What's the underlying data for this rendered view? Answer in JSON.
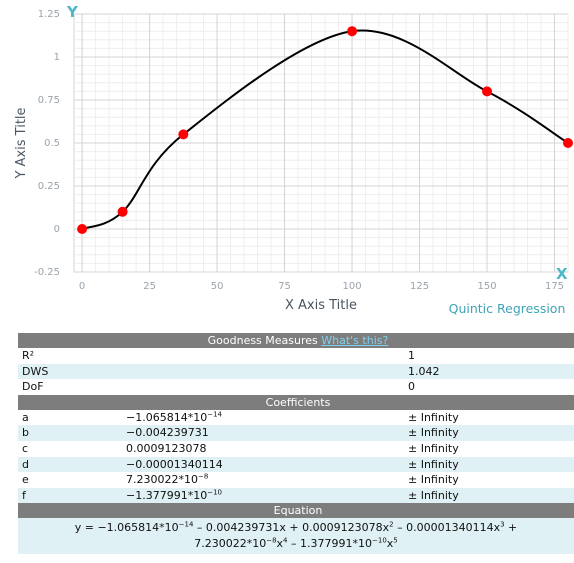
{
  "chart_data": {
    "type": "line",
    "xlabel": "X Axis Title",
    "ylabel": "Y Axis Title",
    "regression_label": "Quintic Regression",
    "axis_badges": {
      "y": "Y",
      "x": "X"
    },
    "xlim": [
      -3,
      180
    ],
    "ylim": [
      -0.25,
      1.25
    ],
    "x_ticks": [
      0,
      25,
      50,
      75,
      100,
      125,
      150,
      175
    ],
    "y_ticks": [
      -0.25,
      0,
      0.25,
      0.5,
      0.75,
      1,
      1.25
    ],
    "x_tick_labels": [
      "0",
      "25",
      "50",
      "75",
      "100",
      "125",
      "150",
      "175"
    ],
    "y_tick_labels": [
      "-0.25",
      "0",
      "0.25",
      "0.5",
      "0.75",
      "1",
      "1.25"
    ],
    "grid": true,
    "series": [
      {
        "points": [
          {
            "x": 0,
            "y": 0
          },
          {
            "x": 15,
            "y": 0.1
          },
          {
            "x": 37.5,
            "y": 0.55
          },
          {
            "x": 100,
            "y": 1.15
          },
          {
            "x": 150,
            "y": 0.8
          },
          {
            "x": 180,
            "y": 0.5
          }
        ],
        "point_color": "#ff0000",
        "curve_color": "#000000",
        "curve_coefficients": [
          -1.065814e-14,
          -0.004239731,
          0.0009123078,
          -1.340114e-05,
          7.230022e-08,
          -1.377991e-10
        ]
      }
    ]
  },
  "colors": {
    "accent": "#4fb6c6",
    "header_bar": "#7d7d7d",
    "row_alt": "#dff1f5",
    "point": "#ff0000",
    "link": "#7fd0ef"
  },
  "table": {
    "goodness_header": "Goodness Measures",
    "whats_this": "What's this?",
    "goodness": [
      {
        "label": "R²",
        "value": "1"
      },
      {
        "label": "DWS",
        "value": "1.042"
      },
      {
        "label": "DoF",
        "value": "0"
      }
    ],
    "coefficients_header": "Coefficients",
    "coefficients": [
      {
        "name": "a",
        "mantissa": "−1.065814*10",
        "exp": "−14",
        "error": "± Infinity"
      },
      {
        "name": "b",
        "mantissa": "−0.004239731",
        "exp": "",
        "error": "± Infinity"
      },
      {
        "name": "c",
        "mantissa": "0.0009123078",
        "exp": "",
        "error": "± Infinity"
      },
      {
        "name": "d",
        "mantissa": "−0.00001340114",
        "exp": "",
        "error": "± Infinity"
      },
      {
        "name": "e",
        "mantissa": "7.230022*10",
        "exp": "−8",
        "error": "± Infinity"
      },
      {
        "name": "f",
        "mantissa": "−1.377991*10",
        "exp": "−10",
        "error": "± Infinity"
      }
    ],
    "equation_header": "Equation",
    "equation": {
      "p1": "y = −1.065814*10",
      "e1": "−14",
      "p2": " – 0.004239731x + 0.0009123078x",
      "e2": "2",
      "p3": " – 0.00001340114x",
      "e3": "3",
      "p4": " +",
      "p5": "7.230022*10",
      "e5": "−8",
      "p6": "x",
      "e6": "4",
      "p7": " – 1.377991*10",
      "e7": "−10",
      "p8": "x",
      "e8": "5"
    }
  }
}
